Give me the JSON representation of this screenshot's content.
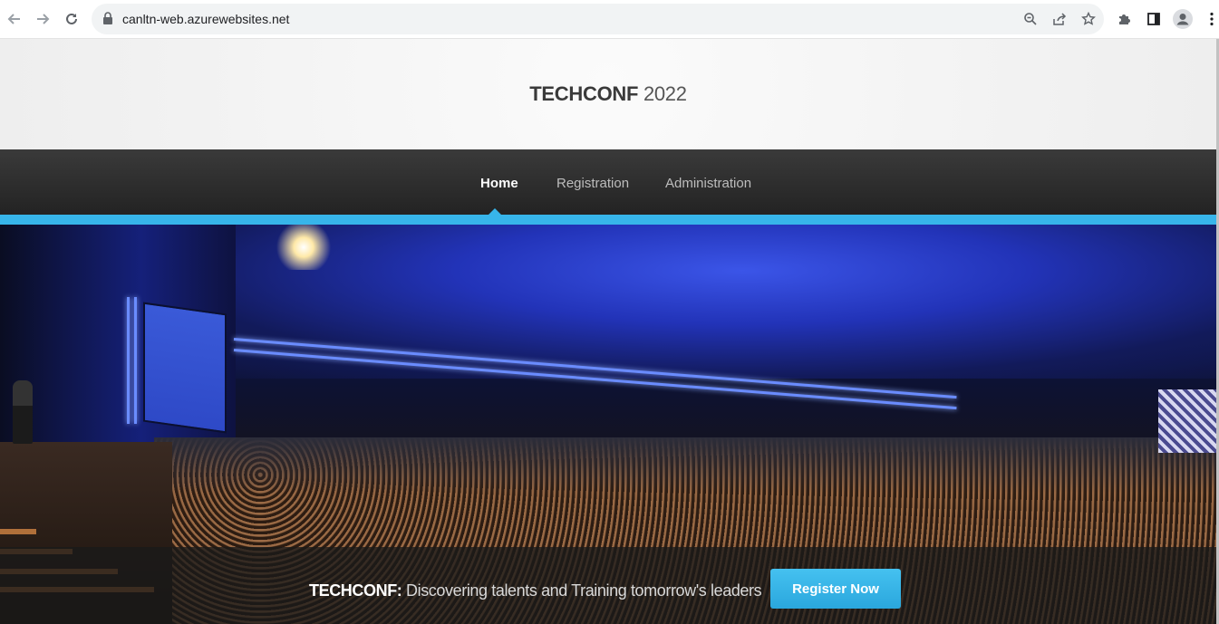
{
  "browser": {
    "url": "canltn-web.azurewebsites.net",
    "icons": {
      "back": "arrow-left-icon",
      "forward": "arrow-right-icon",
      "reload": "reload-icon",
      "lock": "lock-icon",
      "zoom": "zoom-icon",
      "share": "share-icon",
      "bookmark": "star-icon",
      "extensions": "puzzle-icon",
      "side_panel": "side-panel-icon",
      "profile": "profile-icon",
      "menu": "kebab-menu-icon"
    }
  },
  "site": {
    "brand": "TECHCONF",
    "year": "2022",
    "nav": [
      {
        "label": "Home",
        "active": true
      },
      {
        "label": "Registration",
        "active": false
      },
      {
        "label": "Administration",
        "active": false
      }
    ],
    "hero": {
      "tagline_brand": "TECHCONF:",
      "tagline_text": "Discovering talents and Training tomorrow's leaders",
      "cta_label": "Register Now"
    },
    "colors": {
      "accent": "#37b5ea",
      "nav_bg": "#2b2b2b",
      "header_bg": "#f4f4f4"
    }
  }
}
